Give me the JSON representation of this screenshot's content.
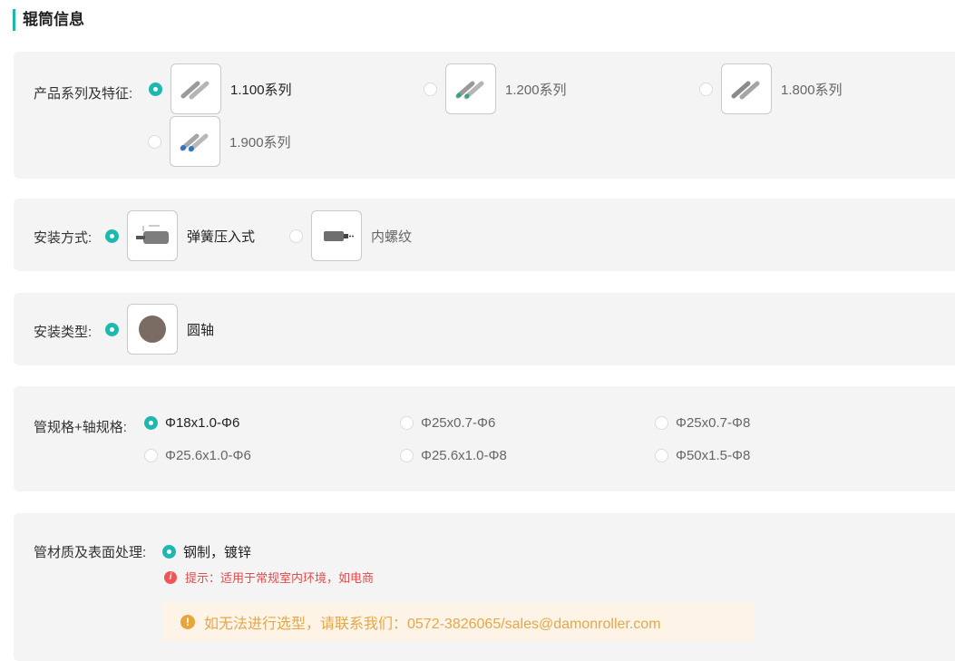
{
  "section_title": "辊筒信息",
  "series": {
    "label": "产品系列及特征:",
    "options": [
      {
        "text": "1.100系列",
        "checked": true,
        "icon": "roller-gray-icon"
      },
      {
        "text": "1.200系列",
        "checked": false,
        "icon": "roller-green-icon"
      },
      {
        "text": "1.800系列",
        "checked": false,
        "icon": "roller-gray-icon"
      },
      {
        "text": "1.900系列",
        "checked": false,
        "icon": "roller-blue-icon"
      }
    ]
  },
  "install_method": {
    "label": "安装方式:",
    "options": [
      {
        "text": "弹簧压入式",
        "checked": true,
        "icon": "spring-shaft-icon"
      },
      {
        "text": "内螺纹",
        "checked": false,
        "icon": "internal-thread-icon"
      }
    ]
  },
  "install_type": {
    "label": "安装类型:",
    "options": [
      {
        "text": "圆轴",
        "checked": true,
        "icon": "round-shaft-icon"
      }
    ]
  },
  "tube_spec": {
    "label": "管规格+轴规格:",
    "options": [
      {
        "text": "Φ18x1.0-Φ6",
        "checked": true
      },
      {
        "text": "Φ25x0.7-Φ6",
        "checked": false
      },
      {
        "text": "Φ25x0.7-Φ8",
        "checked": false
      },
      {
        "text": "Φ25.6x1.0-Φ6",
        "checked": false
      },
      {
        "text": "Φ25.6x1.0-Φ8",
        "checked": false
      },
      {
        "text": "Φ50x1.5-Φ8",
        "checked": false
      }
    ]
  },
  "material": {
    "label": "管材质及表面处理:",
    "options": [
      {
        "text": "钢制，镀锌",
        "checked": true
      }
    ],
    "hint": "提示：适用于常规室内环境，如电商"
  },
  "notice": "如无法进行选型，请联系我们：0572-3826065/sales@damonroller.com",
  "colors": {
    "accent": "#1fb8b0",
    "hint": "#e14c4c",
    "notice_text": "#e4a84a",
    "notice_bg": "#fdf3e6"
  }
}
